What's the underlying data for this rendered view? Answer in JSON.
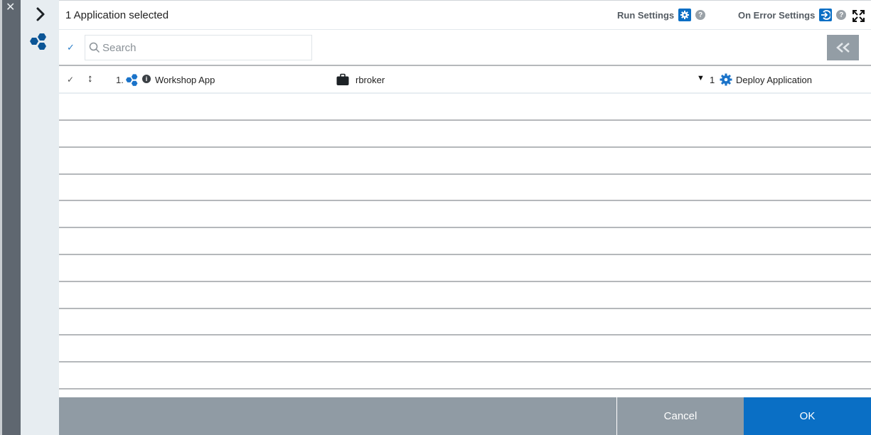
{
  "window": {
    "close_icon": "close-icon",
    "expand_panel_icon": "chevron-right-icon",
    "app_logo_icon": "hexagon-cluster-icon"
  },
  "header": {
    "title": "1 Application selected",
    "run_settings_label": "Run Settings",
    "on_error_settings_label": "On Error Settings",
    "help_glyph": "?",
    "fullscreen_icon": "expand-arrows-icon"
  },
  "toolbar": {
    "select_all_glyph": "✓",
    "search_placeholder": "Search",
    "search_value": "",
    "collapse_glyph": "<<"
  },
  "rows": [
    {
      "checked_glyph": "✓",
      "drag_glyph": "↕",
      "index": "1.",
      "info_glyph": "i",
      "name": "Workshop App",
      "user": "rbroker",
      "expand_glyph": "▼",
      "action_count": "1",
      "action": "Deploy Application"
    }
  ],
  "empty_row_count": 11,
  "footer": {
    "cancel_label": "Cancel",
    "ok_label": "OK"
  },
  "colors": {
    "accent": "#0a6fc5",
    "logo": "#0b5596",
    "footer": "#909ba4",
    "sidebar": "#e7edf1",
    "close_rail": "#5f6770"
  }
}
